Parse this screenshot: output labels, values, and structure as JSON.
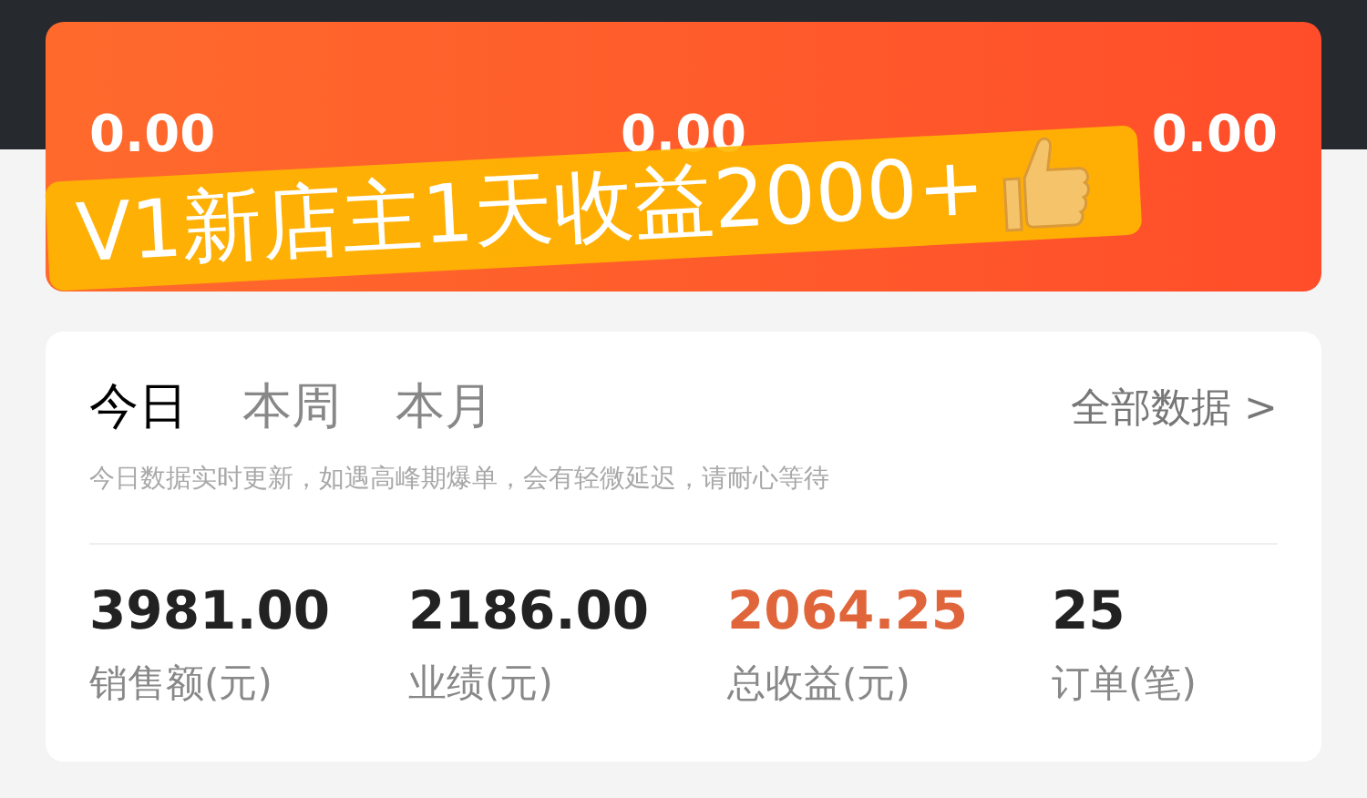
{
  "earnings_card": {
    "values": [
      "0.00",
      "0.00",
      "0.00"
    ]
  },
  "banner": {
    "text": "V1新店主1天收益2000+"
  },
  "stats_card": {
    "tabs": [
      {
        "label": "今日",
        "selected": true
      },
      {
        "label": "本周",
        "selected": false
      },
      {
        "label": "本月",
        "selected": false
      }
    ],
    "all_data_link": "全部数据 >",
    "hint": "今日数据实时更新，如遇高峰期爆单，会有轻微延迟，请耐心等待",
    "metrics": [
      {
        "value": "3981.00",
        "label": "销售额(元)",
        "highlight": false
      },
      {
        "value": "2186.00",
        "label": "业绩(元)",
        "highlight": false
      },
      {
        "value": "2064.25",
        "label": "总收益(元)",
        "highlight": true
      },
      {
        "value": "25",
        "label": "订单(笔)",
        "highlight": false
      }
    ]
  }
}
